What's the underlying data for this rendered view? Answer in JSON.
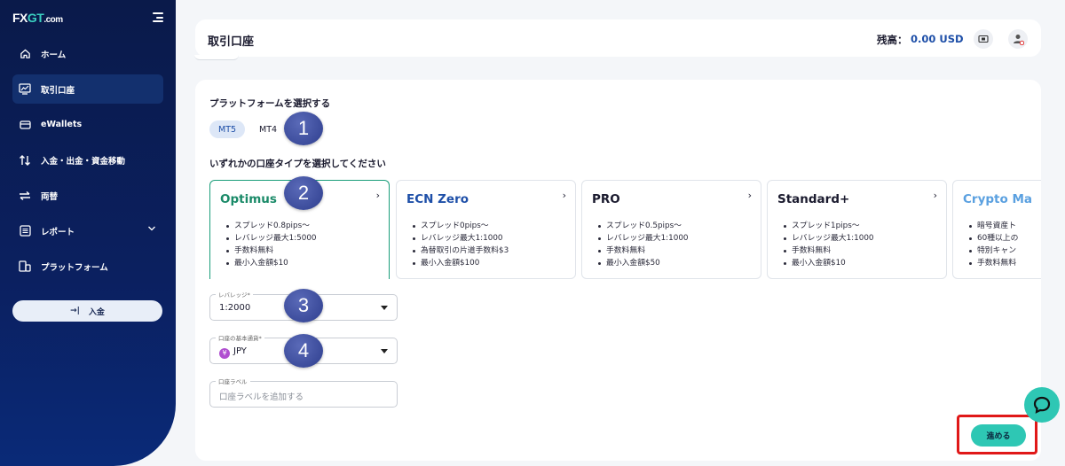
{
  "brand": {
    "logo_fx": "FX",
    "logo_gt": "GT",
    "logo_dom": ".com"
  },
  "sidebar": {
    "items": [
      {
        "label": "ホーム",
        "icon": "home-icon"
      },
      {
        "label": "取引口座",
        "icon": "chart-icon",
        "active": true
      },
      {
        "label": "eWallets",
        "icon": "wallet-icon"
      },
      {
        "label": "入金・出金・資金移動",
        "icon": "transfer-icon"
      },
      {
        "label": "両替",
        "icon": "exchange-icon"
      },
      {
        "label": "レポート",
        "icon": "report-icon",
        "has_chevron": true
      },
      {
        "label": "プラットフォーム",
        "icon": "platform-icon"
      }
    ],
    "deposit_label": "入金"
  },
  "header": {
    "title": "取引口座",
    "balance_label": "残高：",
    "balance_value": "0.00 USD"
  },
  "platform": {
    "heading": "プラットフォームを選択する",
    "tabs": [
      {
        "label": "MT5",
        "active": true
      },
      {
        "label": "MT4",
        "active": false
      }
    ]
  },
  "account_type": {
    "heading": "いずれかの口座タイプを選択してください",
    "cards": [
      {
        "name": "Optimus",
        "selected": true,
        "features": [
          "スプレッド0.8pips〜",
          "レバレッジ最大1:5000",
          "手数料無料",
          "最小入金額$10"
        ]
      },
      {
        "name": "ECN Zero",
        "selected": false,
        "features": [
          "スプレッド0pips〜",
          "レバレッジ最大1:1000",
          "為替取引の片道手数料$3",
          "最小入金額$100"
        ]
      },
      {
        "name": "PRO",
        "selected": false,
        "features": [
          "スプレッド0.5pips〜",
          "レバレッジ最大1:1000",
          "手数料無料",
          "最小入金額$50"
        ]
      },
      {
        "name": "Standard+",
        "selected": false,
        "features": [
          "スプレッド1pips〜",
          "レバレッジ最大1:1000",
          "手数料無料",
          "最小入金額$10"
        ]
      },
      {
        "name": "Crypto Ma",
        "selected": false,
        "features": [
          "暗号資産ト",
          "60種以上の",
          "特別キャン",
          "手数料無料"
        ]
      }
    ]
  },
  "form": {
    "leverage": {
      "label": "レバレッジ*",
      "value": "1:2000"
    },
    "currency": {
      "label": "口座の基本通貨*",
      "value": "JPY",
      "symbol": "¥"
    },
    "account_label": {
      "label": "口座ラベル",
      "placeholder": "口座ラベルを追加する"
    }
  },
  "badges": [
    "1",
    "2",
    "3",
    "4"
  ],
  "next_label": "進める",
  "colors": {
    "sidebar": "#0b2060",
    "accent": "#2ec7b4",
    "selected_border": "#1a9e7a",
    "highlight": "#e01818",
    "badge": "#3e4e9e"
  }
}
